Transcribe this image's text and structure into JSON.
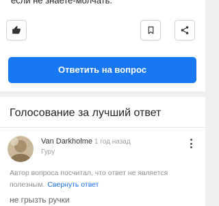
{
  "answer": {
    "text": "если не знаете-молчать."
  },
  "actions": {
    "like_icon": "thumbs-up-icon",
    "bookmark_icon": "bookmark-icon",
    "share_icon": "share-icon",
    "answer_button_label": "Ответить на вопрос"
  },
  "vote_section": {
    "title": "Голосование за лучший ответ",
    "author": {
      "name": "Van Darkholme",
      "time": "1 год назад",
      "rank": "Гуру"
    },
    "note": "Автор вопроса посчитал, что ответ не является полезным.",
    "collapse_link": "Свернуть ответ",
    "answer_text": "не грызть ручки"
  },
  "colors": {
    "accent": "#1877f2",
    "link": "#1a73e8",
    "background": "#eef0f2"
  }
}
